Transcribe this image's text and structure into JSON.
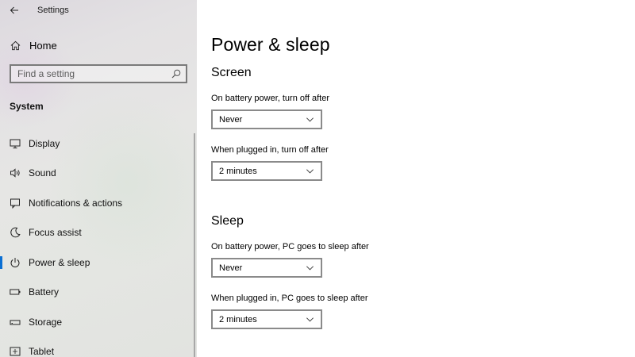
{
  "window": {
    "title": "Settings"
  },
  "sidebar": {
    "home_label": "Home",
    "search_placeholder": "Find a setting",
    "section_heading": "System",
    "items": [
      {
        "label": "Display",
        "icon": "monitor-icon"
      },
      {
        "label": "Sound",
        "icon": "speaker-icon"
      },
      {
        "label": "Notifications & actions",
        "icon": "notification-icon"
      },
      {
        "label": "Focus assist",
        "icon": "moon-icon"
      },
      {
        "label": "Power & sleep",
        "icon": "power-icon",
        "active": true
      },
      {
        "label": "Battery",
        "icon": "battery-icon"
      },
      {
        "label": "Storage",
        "icon": "storage-icon"
      },
      {
        "label": "Tablet",
        "icon": "tablet-icon"
      }
    ]
  },
  "main": {
    "page_title": "Power & sleep",
    "screen": {
      "title": "Screen",
      "battery_label": "On battery power, turn off after",
      "battery_value": "Never",
      "plugged_label": "When plugged in, turn off after",
      "plugged_value": "2 minutes"
    },
    "sleep": {
      "title": "Sleep",
      "battery_label": "On battery power, PC goes to sleep after",
      "battery_value": "Never",
      "plugged_label": "When plugged in, PC goes to sleep after",
      "plugged_value": "2 minutes"
    }
  },
  "colors": {
    "accent": "#0a6fd3",
    "dropdown_border": "#8a8a8a",
    "sidebar_bg": "#e4e4e2"
  }
}
